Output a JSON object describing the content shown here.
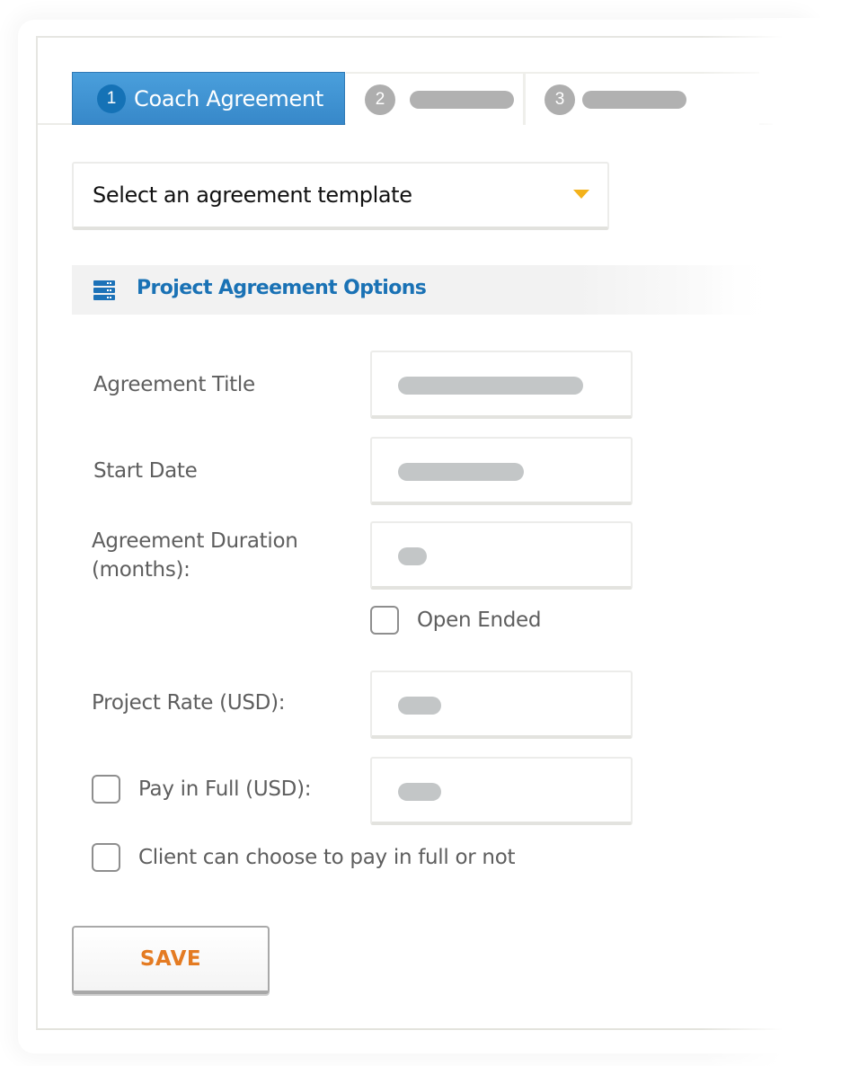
{
  "steps": [
    {
      "number": "1",
      "label": "Coach Agreement",
      "active": true
    },
    {
      "number": "2",
      "label": null,
      "active": false
    },
    {
      "number": "3",
      "label": null,
      "active": false
    }
  ],
  "template_select": {
    "selected": "Select an agreement template",
    "icon": "caret-down-icon"
  },
  "section": {
    "title": "Project Agreement Options",
    "icon": "server-stack-icon"
  },
  "form": {
    "agreement_title": {
      "label": "Agreement Title",
      "value": ""
    },
    "start_date": {
      "label": "Start Date",
      "value": ""
    },
    "duration": {
      "label_line1": "Agreement Duration",
      "label_line2": "(months):",
      "value": ""
    },
    "open_ended": {
      "label": "Open Ended",
      "checked": false
    },
    "project_rate": {
      "label": "Project Rate (USD):",
      "value": ""
    },
    "pay_in_full": {
      "label": "Pay in Full (USD):",
      "checked": false,
      "value": ""
    },
    "client_choice": {
      "label": "Client can choose to pay in full or not",
      "checked": false
    }
  },
  "actions": {
    "save_label": "SAVE"
  },
  "colors": {
    "active_tab": "#3a8ccc",
    "section_title": "#1a72b5",
    "caret": "#f3b21b",
    "save_text": "#e47b22"
  }
}
